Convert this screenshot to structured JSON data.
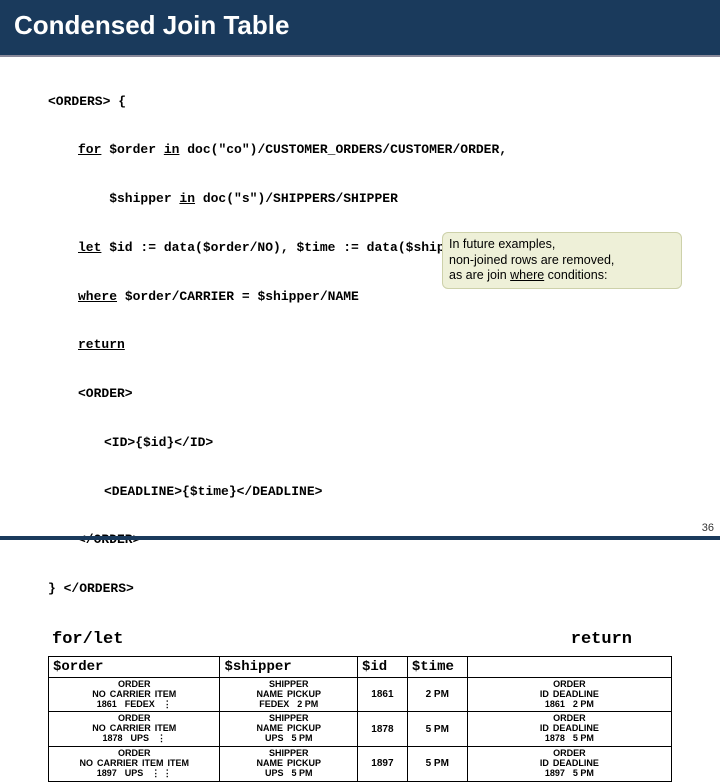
{
  "header": {
    "title": "Condensed Join Table"
  },
  "code": {
    "l1": "<ORDERS> {",
    "l2a": "for",
    "l2b": " $order ",
    "l2c": "in",
    "l2d": " doc(\"co\")/CUSTOMER_ORDERS/CUSTOMER/ORDER,",
    "l3a": "    $shipper ",
    "l3b": "in",
    "l3c": " doc(\"s\")/SHIPPERS/SHIPPER",
    "l4a": "let",
    "l4b": " $id := data($order/NO), $time := data($shipper/PICKUP)",
    "l5a": "where",
    "l5b": " $order/CARRIER = $shipper/NAME",
    "l6": "return",
    "l7": "<ORDER>",
    "l8": "<ID>{$id}</ID>",
    "l9": "<DEADLINE>{$time}</DEADLINE>",
    "l10": "</ORDER>",
    "l11": "} </ORDERS>"
  },
  "note": {
    "t1": "In future examples,",
    "t2": "non-joined rows are removed,",
    "t3": "as are join ",
    "t4": "where",
    "t5": " conditions:"
  },
  "labels": {
    "forlet": "for/let",
    "ret": "return"
  },
  "head": {
    "order": "$order",
    "shipper": "$shipper",
    "id": "$id",
    "time": "$time",
    "retblank": " "
  },
  "col": {
    "order": "ORDER",
    "shipper": "SHIPPER",
    "no": "NO",
    "carrier": "CARRIER",
    "item": "ITEM",
    "name": "NAME",
    "pickup": "PICKUP",
    "id": "ID",
    "deadline": "DEADLINE"
  },
  "rows": [
    {
      "no": "1861",
      "carrier": "FEDEX",
      "items": "⋮",
      "name": "FEDEX",
      "pickup": "2 PM",
      "id": "1861",
      "time": "2 PM",
      "rid": "1861",
      "rdl": "2 PM"
    },
    {
      "no": "1878",
      "carrier": "UPS",
      "items": "⋮",
      "name": "UPS",
      "pickup": "5 PM",
      "id": "1878",
      "time": "5 PM",
      "rid": "1878",
      "rdl": "5 PM"
    },
    {
      "no": "1897",
      "carrier": "UPS",
      "items": "⋮  ⋮",
      "name": "UPS",
      "pickup": "5 PM",
      "id": "1897",
      "time": "5 PM",
      "rid": "1897",
      "rdl": "5 PM",
      "extra_item": "ITEM"
    }
  ],
  "slide": "36"
}
